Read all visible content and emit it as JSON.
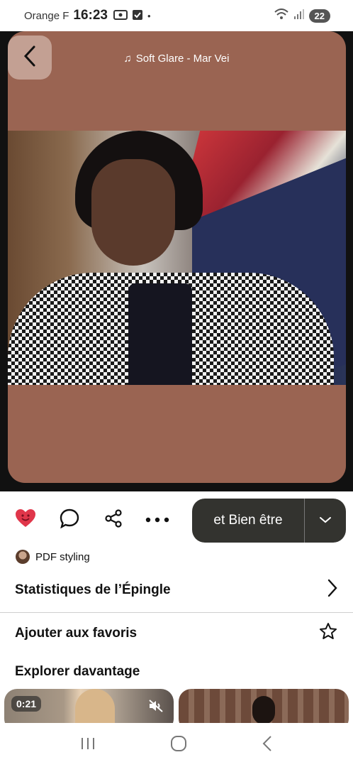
{
  "status_bar": {
    "carrier": "Orange F",
    "time": "16:23",
    "battery": "22"
  },
  "media": {
    "music_track": "Soft Glare - Mar Vei",
    "background_color": "#9a6452"
  },
  "actions": {
    "board_label": "et Bien être"
  },
  "author": {
    "name": "PDF styling"
  },
  "menu": {
    "stats_label": "Statistiques de l’Épingle",
    "favorites_label": "Ajouter aux favoris"
  },
  "explore": {
    "title": "Explorer davantage",
    "video_duration": "0:21"
  },
  "colors": {
    "accent_heart": "#e0364a",
    "board_button": "#33332f"
  }
}
